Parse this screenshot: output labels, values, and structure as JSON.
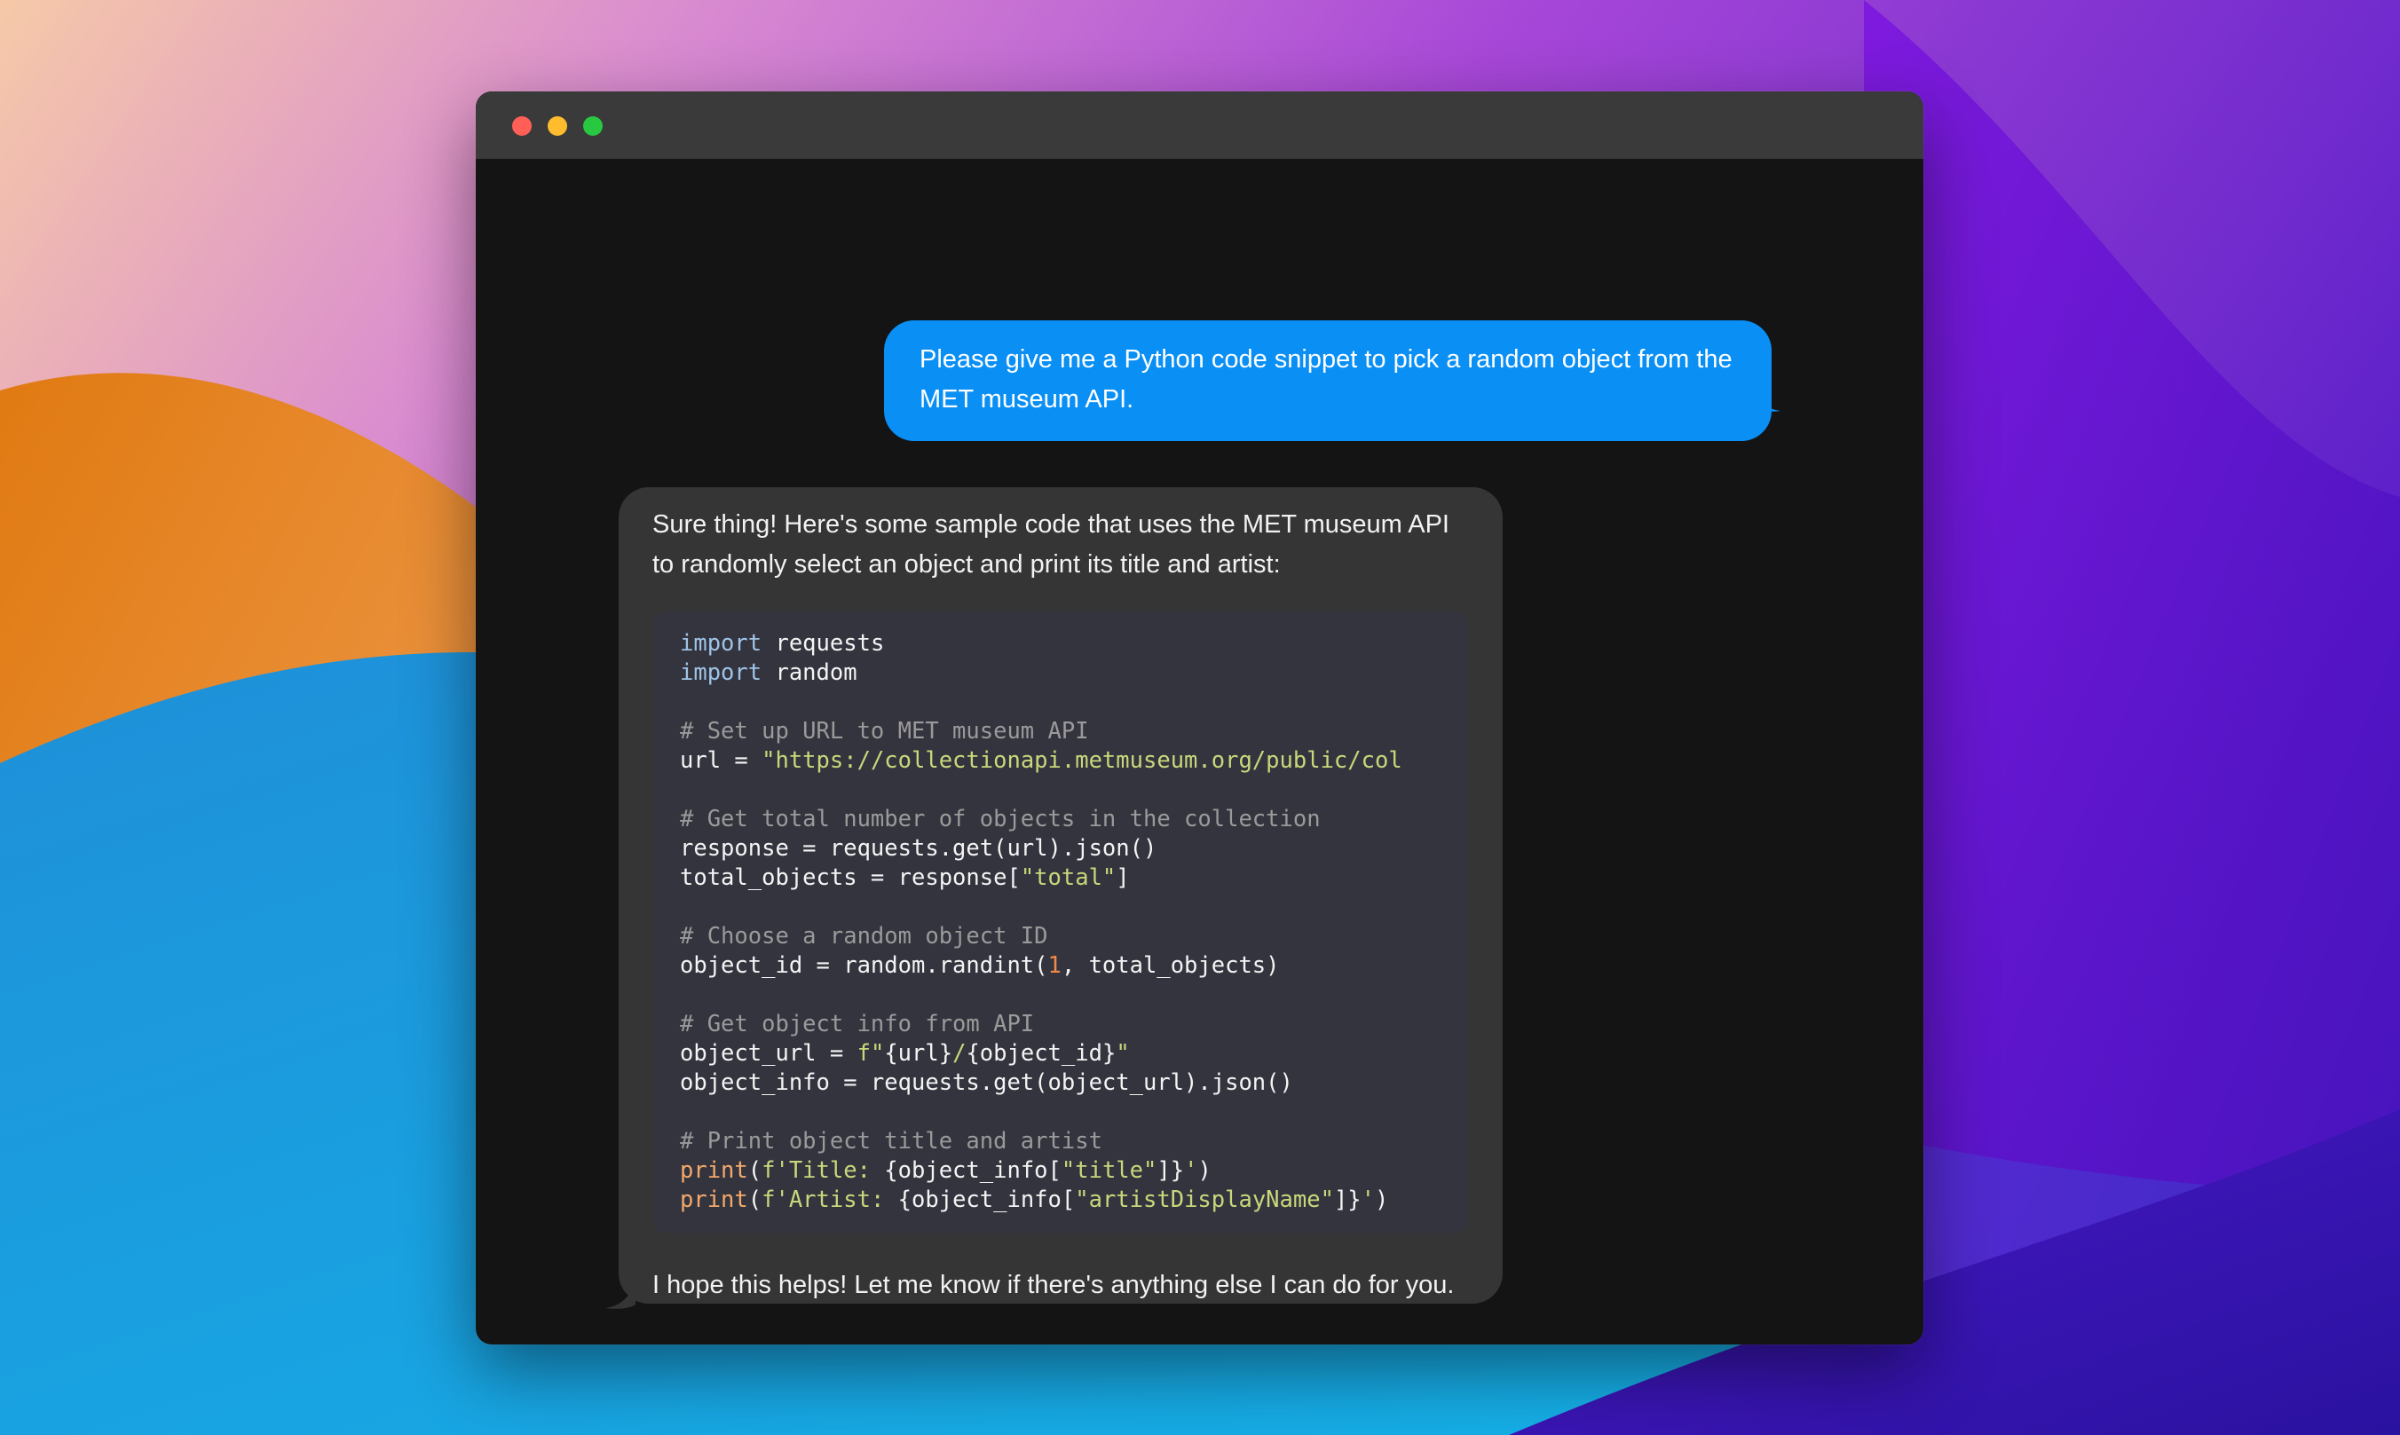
{
  "colors": {
    "user_bubble": "#0a8ff5",
    "assistant_bubble": "#353535",
    "window_bg": "#141414",
    "code_bg": "#34343f"
  },
  "window": {
    "controls": [
      "close",
      "minimize",
      "zoom"
    ]
  },
  "messages": {
    "user": {
      "text": "Please give me a Python code snippet to pick a random object from the MET museum API."
    },
    "assistant": {
      "intro": "Sure thing! Here's some sample code that uses the MET museum API to randomly select an object and print its title and artist:",
      "outro": "I hope this helps! Let me know if there's anything else I can do for you.",
      "code_lines": [
        [
          {
            "t": "kw",
            "v": "import"
          },
          {
            "t": "txt",
            "v": " requests"
          }
        ],
        [
          {
            "t": "kw",
            "v": "import"
          },
          {
            "t": "txt",
            "v": " random"
          }
        ],
        [],
        [
          {
            "t": "com",
            "v": "# Set up URL to MET museum API"
          }
        ],
        [
          {
            "t": "txt",
            "v": "url = "
          },
          {
            "t": "str",
            "v": "\"https://collectionapi.metmuseum.org/public/col"
          }
        ],
        [],
        [
          {
            "t": "com",
            "v": "# Get total number of objects in the collection"
          }
        ],
        [
          {
            "t": "txt",
            "v": "response = requests.get(url).json()"
          }
        ],
        [
          {
            "t": "txt",
            "v": "total_objects = response["
          },
          {
            "t": "str",
            "v": "\"total\""
          },
          {
            "t": "txt",
            "v": "]"
          }
        ],
        [],
        [
          {
            "t": "com",
            "v": "# Choose a random object ID"
          }
        ],
        [
          {
            "t": "txt",
            "v": "object_id = random.randint("
          },
          {
            "t": "num",
            "v": "1"
          },
          {
            "t": "txt",
            "v": ", total_objects)"
          }
        ],
        [],
        [
          {
            "t": "com",
            "v": "# Get object info from API"
          }
        ],
        [
          {
            "t": "txt",
            "v": "object_url = "
          },
          {
            "t": "str",
            "v": "f\""
          },
          {
            "t": "txt",
            "v": "{url}"
          },
          {
            "t": "str",
            "v": "/"
          },
          {
            "t": "txt",
            "v": "{object_id}"
          },
          {
            "t": "str",
            "v": "\""
          }
        ],
        [
          {
            "t": "txt",
            "v": "object_info = requests.get(object_url).json()"
          }
        ],
        [],
        [
          {
            "t": "com",
            "v": "# Print object title and artist"
          }
        ],
        [
          {
            "t": "fn",
            "v": "print"
          },
          {
            "t": "txt",
            "v": "("
          },
          {
            "t": "str",
            "v": "f'Title: "
          },
          {
            "t": "txt",
            "v": "{object_info["
          },
          {
            "t": "str",
            "v": "\"title\""
          },
          {
            "t": "txt",
            "v": "]}"
          },
          {
            "t": "str",
            "v": "'"
          },
          {
            "t": "txt",
            "v": ")"
          }
        ],
        [
          {
            "t": "fn",
            "v": "print"
          },
          {
            "t": "txt",
            "v": "("
          },
          {
            "t": "str",
            "v": "f'Artist: "
          },
          {
            "t": "txt",
            "v": "{object_info["
          },
          {
            "t": "str",
            "v": "\"artistDisplayName\""
          },
          {
            "t": "txt",
            "v": "]}"
          },
          {
            "t": "str",
            "v": "'"
          },
          {
            "t": "txt",
            "v": ")"
          }
        ]
      ]
    }
  }
}
